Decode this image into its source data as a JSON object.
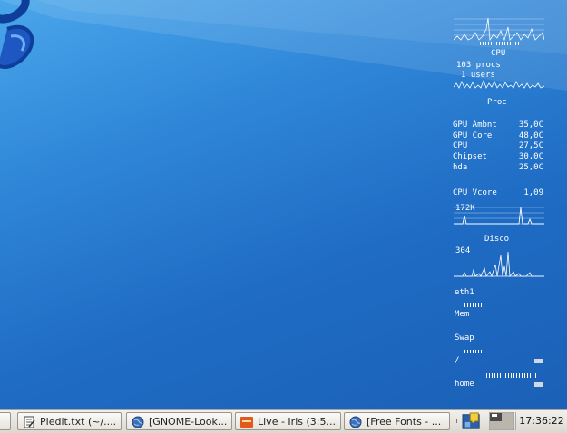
{
  "monitor": {
    "cpu_label": "CPU",
    "procs": "103 procs",
    "users": "1 users",
    "proc_label": "Proc",
    "sensors": [
      {
        "name": "GPU Ambnt",
        "value": "35,0C"
      },
      {
        "name": "GPU Core",
        "value": "48,0C"
      },
      {
        "name": "CPU",
        "value": "27,5C"
      },
      {
        "name": "Chipset",
        "value": "30,0C"
      },
      {
        "name": "hda",
        "value": "25,0C"
      }
    ],
    "vcore_label": "CPU Vcore",
    "vcore_value": "1,09",
    "disk_rate": "172K",
    "disk_label": "Disco",
    "net_rate": "304",
    "net_iface": "eth1",
    "mem_label": "Mem",
    "swap_label": "Swap",
    "root_label": "/",
    "home_label": "home"
  },
  "taskbar": {
    "tasks": [
      {
        "label": "",
        "icon": "window-icon"
      },
      {
        "label": "Pledit.txt (~/....",
        "icon": "text-editor-icon"
      },
      {
        "label": "[GNOME-Look...",
        "icon": "globe-icon"
      },
      {
        "label": "Live - Iris (3:5...",
        "icon": "media-player-icon"
      },
      {
        "label": "[Free Fonts - ...",
        "icon": "globe-icon"
      }
    ],
    "clock": "17:36:22"
  },
  "colors": {
    "desktop_top": "#4aa6ea",
    "desktop_bottom": "#1b5fb6",
    "taskbar_bg": "#e8e5df",
    "monitor_text": "#ffffff"
  }
}
